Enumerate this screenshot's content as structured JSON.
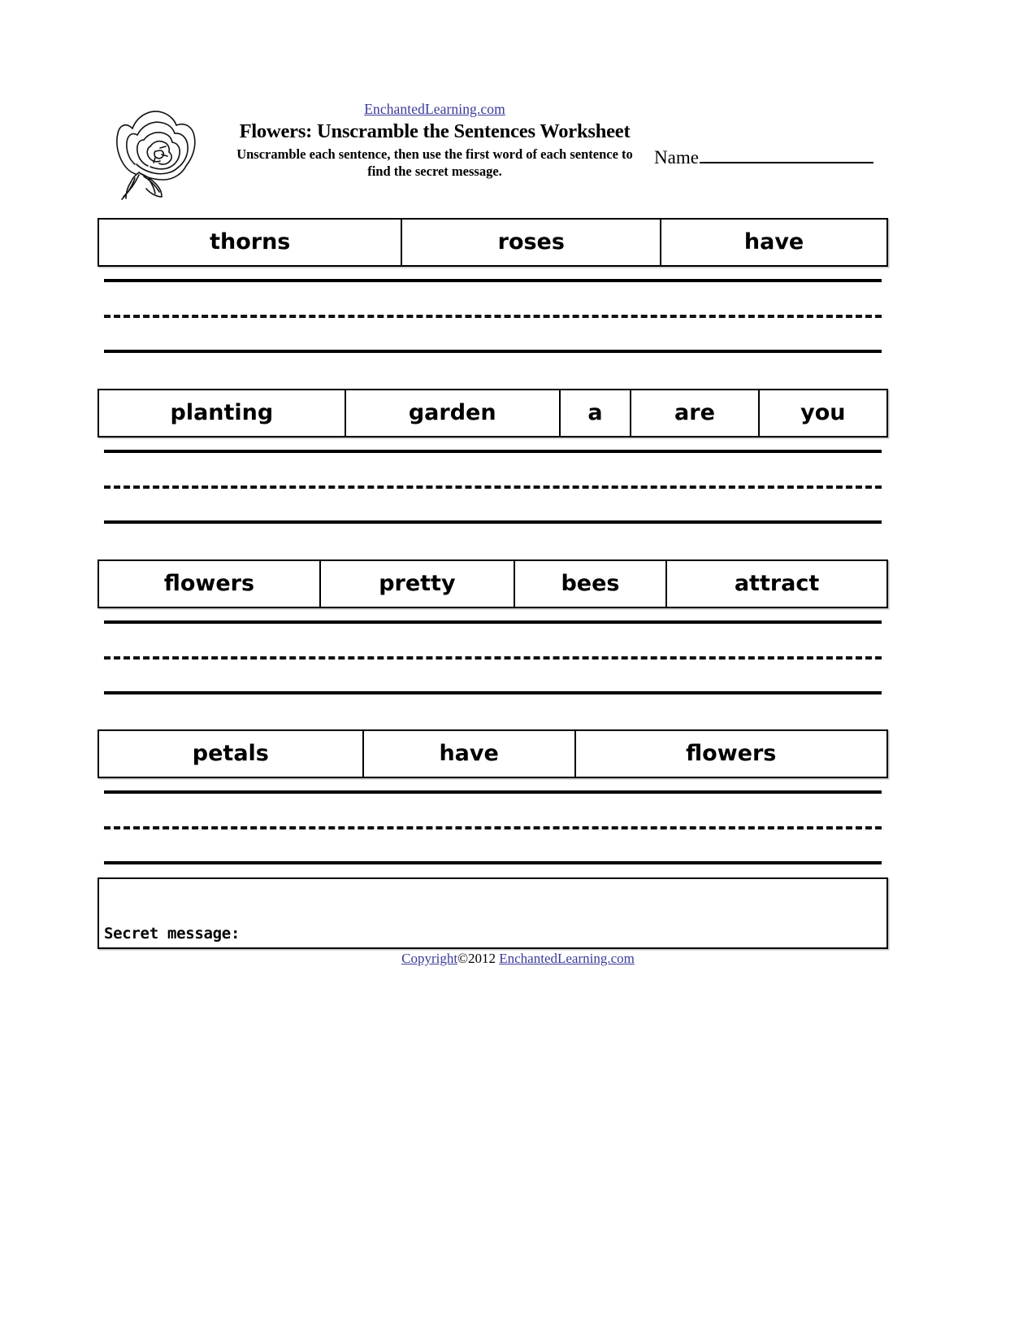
{
  "header": {
    "site_link": "EnchantedLearning.com",
    "title": "Flowers: Unscramble the Sentences Worksheet",
    "instructions": "Unscramble each sentence, then use the first word of each sentence to find the secret message.",
    "name_label": "Name",
    "name_value": "",
    "icon": "rose-icon"
  },
  "colors": {
    "link": "#3a3a9c",
    "ink": "#000000",
    "paper": "#ffffff"
  },
  "exercises": [
    {
      "index": 1,
      "words": [
        "thorns",
        "roses",
        "have"
      ],
      "widths": [
        375,
        320,
        278
      ],
      "answer_line": ""
    },
    {
      "index": 2,
      "words": [
        "planting",
        "garden",
        "a",
        "are",
        "you"
      ],
      "widths": [
        305,
        265,
        88,
        158,
        157
      ],
      "answer_line": ""
    },
    {
      "index": 3,
      "words": [
        "flowers",
        "pretty",
        "bees",
        "attract"
      ],
      "widths": [
        274,
        240,
        188,
        271
      ],
      "answer_line": ""
    },
    {
      "index": 4,
      "words": [
        "petals",
        "have",
        "flowers"
      ],
      "widths": [
        327,
        262,
        384
      ],
      "answer_line": ""
    }
  ],
  "secret": {
    "label": "Secret message:",
    "value": ""
  },
  "footer": {
    "copyright_link": "Copyright",
    "copyright_mid": "©2012 ",
    "site_link": "EnchantedLearning.com"
  }
}
